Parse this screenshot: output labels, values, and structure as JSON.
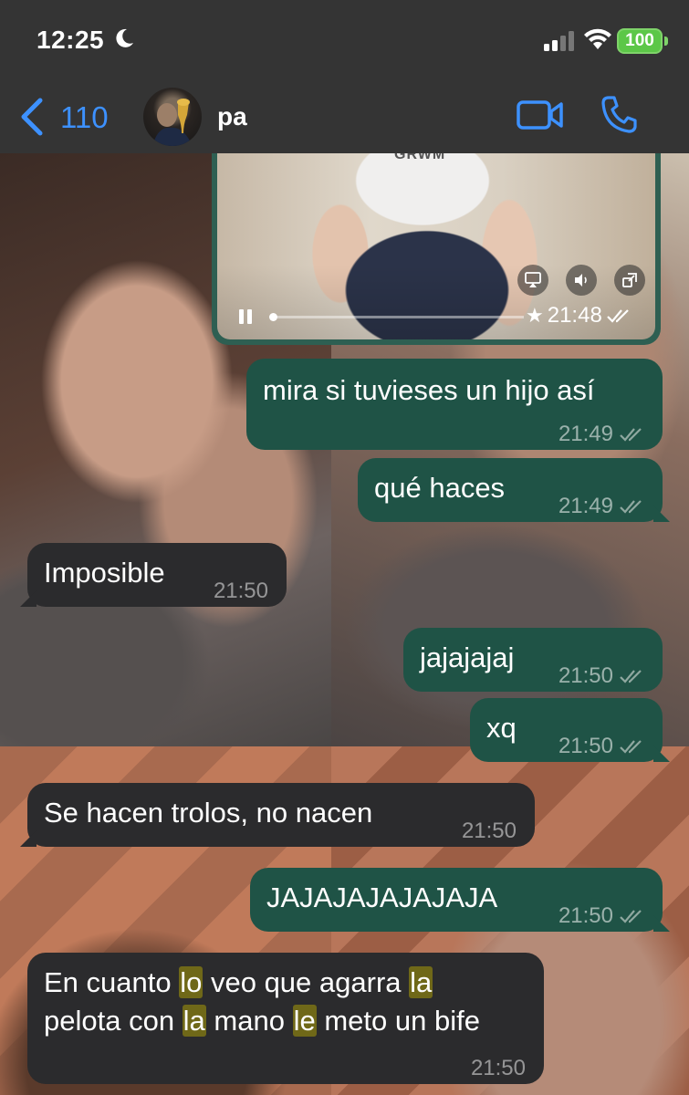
{
  "status_bar": {
    "time": "12:25",
    "battery": "100",
    "icons": [
      "moon-icon",
      "signal-icon",
      "wifi-icon",
      "battery-icon"
    ]
  },
  "header": {
    "back_count": "110",
    "contact_name": "pa",
    "accent_color": "#3d91ff",
    "icons": [
      "chevron-left-icon",
      "video-call-icon",
      "phone-icon"
    ]
  },
  "video_message": {
    "caption": "GRWM",
    "time": "21:48",
    "starred": true
  },
  "messages": [
    {
      "dir": "out",
      "text": "mira si tuvieses un hijo así",
      "time": "21:49"
    },
    {
      "dir": "out",
      "text": "qué haces",
      "time": "21:49"
    },
    {
      "dir": "in",
      "text": "Imposible",
      "time": "21:50"
    },
    {
      "dir": "out",
      "text": "jajajajaj",
      "time": "21:50"
    },
    {
      "dir": "out",
      "text": "xq",
      "time": "21:50"
    },
    {
      "dir": "in",
      "text": "Se hacen trolos, no nacen",
      "time": "21:50"
    },
    {
      "dir": "out",
      "text": "JAJAJAJAJAJAJA",
      "time": "21:50"
    },
    {
      "dir": "in",
      "text": "En cuanto lo veo que agarra la pelota con la mano le meto un bife",
      "parts": [
        "En cuanto ",
        "lo",
        " veo que agarra ",
        "la",
        "pelota con ",
        "la",
        " mano ",
        "le",
        " meto un bife"
      ],
      "time": "21:50"
    }
  ],
  "colors": {
    "outgoing_bubble": "#1f5346",
    "incoming_bubble": "#2b2b2d",
    "highlight": "#6f6818"
  }
}
